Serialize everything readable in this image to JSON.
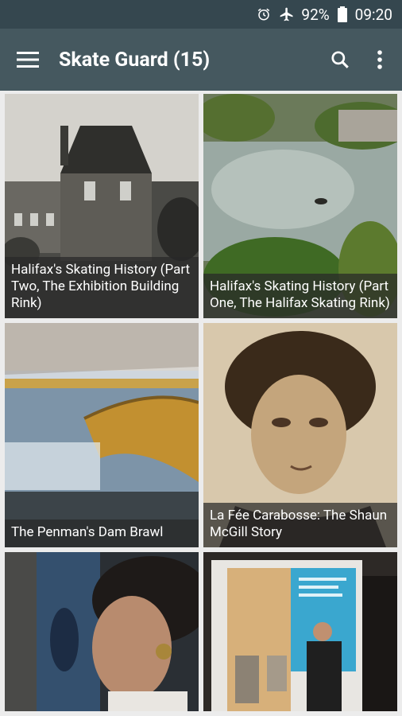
{
  "status": {
    "battery_pct": "92%",
    "time": "09:20"
  },
  "appbar": {
    "title": "Skate Guard (15)"
  },
  "tiles": [
    {
      "caption": "Halifax's Skating History (Part Two, The Exhibition Building Rink)"
    },
    {
      "caption": "Halifax's Skating History (Part One, The Halifax Skating Rink)"
    },
    {
      "caption": "The Penman's Dam Brawl"
    },
    {
      "caption": "La Fée Carabosse: The Shaun McGill Story"
    },
    {
      "caption": ""
    },
    {
      "caption": ""
    }
  ],
  "colors": {
    "statusbar": "#35474f",
    "appbar": "#45585f"
  }
}
